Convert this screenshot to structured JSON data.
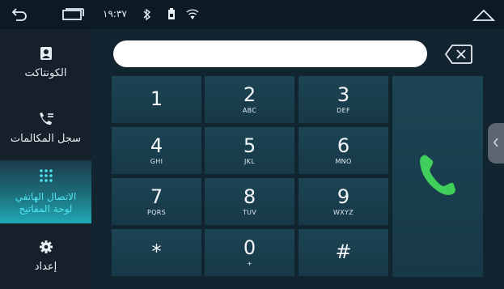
{
  "status_bar": {
    "time": "١٩:٣٧",
    "icons": [
      "back-icon",
      "recent-apps-icon",
      "bluetooth-icon",
      "sim-icon",
      "wifi-icon",
      "home-icon"
    ]
  },
  "sidebar": {
    "items": [
      {
        "label": "الكونتاكت",
        "icon": "contacts-icon",
        "active": false
      },
      {
        "label": "سجل المكالمات",
        "icon": "call-log-icon",
        "active": false
      },
      {
        "label": "الاتصال الهاتفي\nلوحة المفاتيح",
        "icon": "dialpad-icon",
        "active": true
      },
      {
        "label": "إعداد",
        "icon": "settings-icon",
        "active": false
      }
    ]
  },
  "dialer": {
    "number_value": "",
    "keys": [
      {
        "digit": "1",
        "letters": ""
      },
      {
        "digit": "2",
        "letters": "ABC"
      },
      {
        "digit": "3",
        "letters": "DEF"
      },
      {
        "digit": "4",
        "letters": "GHI"
      },
      {
        "digit": "5",
        "letters": "JKL"
      },
      {
        "digit": "6",
        "letters": "MNO"
      },
      {
        "digit": "7",
        "letters": "PQRS"
      },
      {
        "digit": "8",
        "letters": "TUV"
      },
      {
        "digit": "9",
        "letters": "WXYZ"
      },
      {
        "digit": "*",
        "letters": ""
      },
      {
        "digit": "0",
        "letters": "+"
      },
      {
        "digit": "#",
        "letters": ""
      }
    ],
    "call_icon": "phone-call-icon",
    "backspace_icon": "backspace-icon"
  },
  "colors": {
    "accent": "#4fe3ef",
    "call_green": "#3fcf5a",
    "key_bg": "#1d4453"
  }
}
